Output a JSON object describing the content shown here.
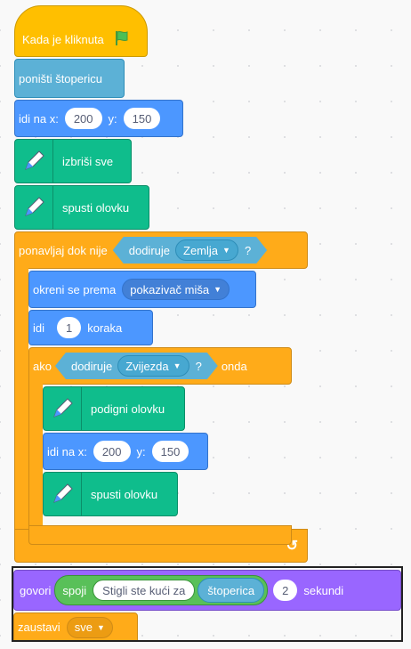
{
  "hat": {
    "label": "Kada je kliknuta"
  },
  "reset_timer": {
    "label": "poništi štopericu"
  },
  "goto1": {
    "label": "idi na x:",
    "x": "200",
    "ylabel": "y:",
    "y": "150"
  },
  "clear": {
    "label": "izbriši sve"
  },
  "pendown1": {
    "label": "spusti olovku"
  },
  "repeat_until": {
    "label": "ponavljaj dok nije",
    "cond_label": "dodiruje",
    "cond_value": "Zemlja",
    "q": "?"
  },
  "point": {
    "label": "okreni se prema",
    "value": "pokazivač miša"
  },
  "move": {
    "label": "idi",
    "steps": "1",
    "unit": "koraka"
  },
  "if_block": {
    "label": "ako",
    "cond_label": "dodiruje",
    "cond_value": "Zvijezda",
    "q": "?",
    "then": "onda"
  },
  "penup": {
    "label": "podigni olovku"
  },
  "goto2": {
    "label": "idi na x:",
    "x": "200",
    "ylabel": "y:",
    "y": "150"
  },
  "pendown2": {
    "label": "spusti olovku"
  },
  "say": {
    "label": "govori",
    "join": "spoji",
    "text": "Stigli ste kući za",
    "timer": "štoperica",
    "secs": "2",
    "unit": "sekundi"
  },
  "stop": {
    "label": "zaustavi",
    "value": "sve"
  },
  "colors": {
    "events": "#ffbf00",
    "motion": "#4c97ff",
    "sensing": "#5cb1d6",
    "pen": "#0fbd8c",
    "control": "#ffab19",
    "looks": "#9966ff",
    "operators": "#59c059"
  }
}
